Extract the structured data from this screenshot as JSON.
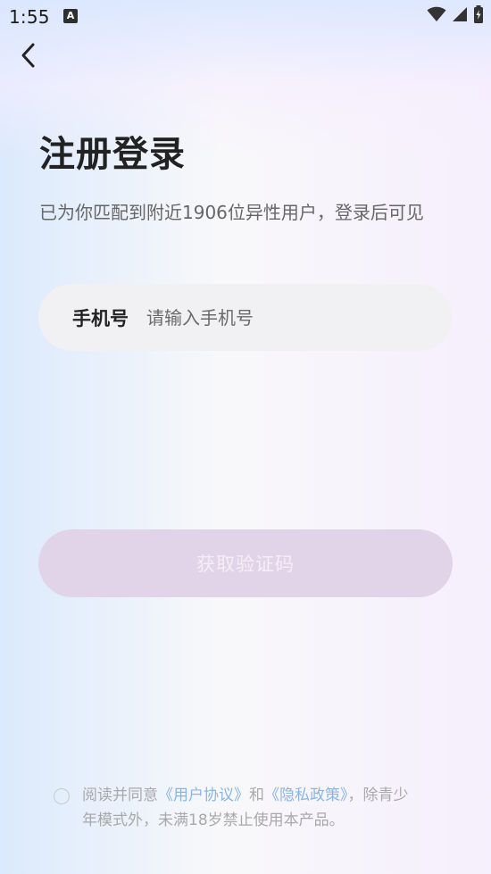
{
  "status_bar": {
    "time": "1:55",
    "notification_icon": "A",
    "icons": [
      "wifi-icon",
      "signal-icon",
      "battery-charging-icon"
    ]
  },
  "header": {
    "back_icon": "chevron-left-icon",
    "title": "注册登录",
    "subtitle": "已为你匹配到附近1906位异性用户，登录后可见"
  },
  "form": {
    "phone_label": "手机号",
    "phone_placeholder": "请输入手机号",
    "phone_value": "",
    "submit_label": "获取验证码"
  },
  "agreement": {
    "prefix": "阅读并同意",
    "user_agreement": "《用户协议》",
    "conjunction": "和",
    "privacy_policy": "《隐私政策》",
    "suffix": "，除青少年模式外，未满18岁禁止使用本产品。",
    "checked": false
  },
  "colors": {
    "accent_disabled": "#e2d4e8",
    "link": "#86b6e6",
    "title": "#222222"
  }
}
